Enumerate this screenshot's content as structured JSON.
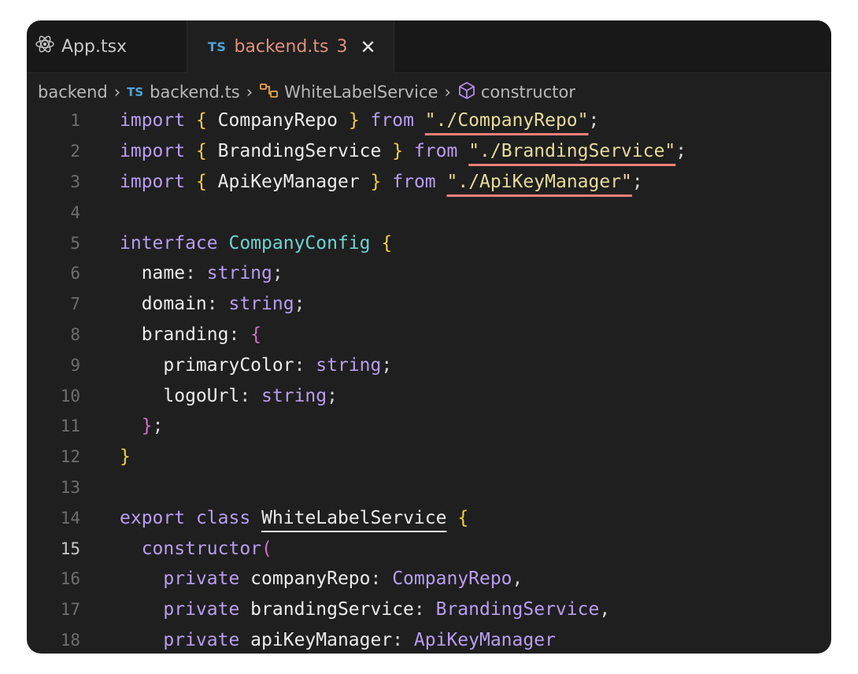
{
  "tabs": [
    {
      "label": "App.tsx",
      "icon": "react-icon",
      "active": false
    },
    {
      "label": "backend.ts",
      "badge": "TS",
      "problems": "3",
      "active": true
    }
  ],
  "breadcrumb": {
    "folder": "backend",
    "file_badge": "TS",
    "file": "backend.ts",
    "class": "WhiteLabelService",
    "member": "constructor"
  },
  "colors": {
    "background": "#1f1f1f",
    "tabbar": "#181818",
    "keyword": "#b99df0",
    "type": "#6fd3d3",
    "string": "#e6dc9a",
    "error_underline": "#f0807a",
    "active_tab_text": "#e0907f"
  },
  "code": {
    "current_line": "15",
    "lines": [
      {
        "n": "1",
        "t": [
          [
            "kw",
            "import"
          ],
          [
            "id",
            " "
          ],
          [
            "brace-y",
            "{"
          ],
          [
            "id",
            " CompanyRepo "
          ],
          [
            "brace-y",
            "}"
          ],
          [
            "id",
            " "
          ],
          [
            "kw",
            "from"
          ],
          [
            "id",
            " "
          ],
          [
            "str err",
            "\"./CompanyRepo\""
          ],
          [
            "punct",
            ";"
          ]
        ]
      },
      {
        "n": "2",
        "t": [
          [
            "kw",
            "import"
          ],
          [
            "id",
            " "
          ],
          [
            "brace-y",
            "{"
          ],
          [
            "id",
            " BrandingService "
          ],
          [
            "brace-y",
            "}"
          ],
          [
            "id",
            " "
          ],
          [
            "kw",
            "from"
          ],
          [
            "id",
            " "
          ],
          [
            "str err",
            "\"./BrandingService\""
          ],
          [
            "punct",
            ";"
          ]
        ]
      },
      {
        "n": "3",
        "t": [
          [
            "kw",
            "import"
          ],
          [
            "id",
            " "
          ],
          [
            "brace-y",
            "{"
          ],
          [
            "id",
            " ApiKeyManager "
          ],
          [
            "brace-y",
            "}"
          ],
          [
            "id",
            " "
          ],
          [
            "kw",
            "from"
          ],
          [
            "id",
            " "
          ],
          [
            "str err",
            "\"./ApiKeyManager\""
          ],
          [
            "punct",
            ";"
          ]
        ]
      },
      {
        "n": "4",
        "t": []
      },
      {
        "n": "5",
        "t": [
          [
            "kw",
            "interface"
          ],
          [
            "id",
            " "
          ],
          [
            "type",
            "CompanyConfig"
          ],
          [
            "id",
            " "
          ],
          [
            "brace-y",
            "{"
          ]
        ]
      },
      {
        "n": "6",
        "t": [
          [
            "id",
            "  name"
          ],
          [
            "punct",
            ": "
          ],
          [
            "ptype",
            "string"
          ],
          [
            "punct",
            ";"
          ]
        ]
      },
      {
        "n": "7",
        "t": [
          [
            "id",
            "  domain"
          ],
          [
            "punct",
            ": "
          ],
          [
            "ptype",
            "string"
          ],
          [
            "punct",
            ";"
          ]
        ]
      },
      {
        "n": "8",
        "t": [
          [
            "id",
            "  branding"
          ],
          [
            "punct",
            ": "
          ],
          [
            "brace-p",
            "{"
          ]
        ]
      },
      {
        "n": "9",
        "t": [
          [
            "id",
            "    primaryColor"
          ],
          [
            "punct",
            ": "
          ],
          [
            "ptype",
            "string"
          ],
          [
            "punct",
            ";"
          ]
        ]
      },
      {
        "n": "10",
        "t": [
          [
            "id",
            "    logoUrl"
          ],
          [
            "punct",
            ": "
          ],
          [
            "ptype",
            "string"
          ],
          [
            "punct",
            ";"
          ]
        ]
      },
      {
        "n": "11",
        "t": [
          [
            "id",
            "  "
          ],
          [
            "brace-p",
            "}"
          ],
          [
            "punct",
            ";"
          ]
        ]
      },
      {
        "n": "12",
        "t": [
          [
            "brace-y",
            "}"
          ]
        ]
      },
      {
        "n": "13",
        "t": []
      },
      {
        "n": "14",
        "t": [
          [
            "kw",
            "export"
          ],
          [
            "id",
            " "
          ],
          [
            "kw",
            "class"
          ],
          [
            "id",
            " "
          ],
          [
            "id uline",
            "WhiteLabelService"
          ],
          [
            "id",
            " "
          ],
          [
            "brace-y",
            "{"
          ]
        ]
      },
      {
        "n": "15",
        "t": [
          [
            "id",
            "  "
          ],
          [
            "kw",
            "constructor"
          ],
          [
            "brace-p",
            "("
          ]
        ]
      },
      {
        "n": "16",
        "t": [
          [
            "id",
            "    "
          ],
          [
            "kw",
            "private"
          ],
          [
            "id",
            " companyRepo"
          ],
          [
            "punct",
            ": "
          ],
          [
            "ptype",
            "CompanyRepo"
          ],
          [
            "punct",
            ","
          ]
        ]
      },
      {
        "n": "17",
        "t": [
          [
            "id",
            "    "
          ],
          [
            "kw",
            "private"
          ],
          [
            "id",
            " brandingService"
          ],
          [
            "punct",
            ": "
          ],
          [
            "ptype",
            "BrandingService"
          ],
          [
            "punct",
            ","
          ]
        ]
      },
      {
        "n": "18",
        "t": [
          [
            "id",
            "    "
          ],
          [
            "kw",
            "private"
          ],
          [
            "id",
            " apiKeyManager"
          ],
          [
            "punct",
            ": "
          ],
          [
            "ptype",
            "ApiKeyManager"
          ]
        ]
      }
    ]
  }
}
